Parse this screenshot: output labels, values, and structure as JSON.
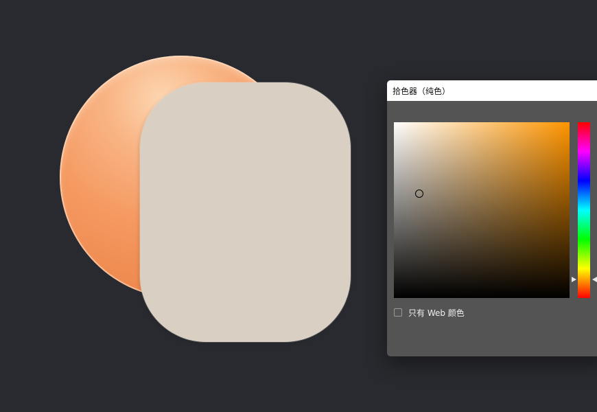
{
  "picker": {
    "title": "拾色器（纯色）",
    "web_colors_only_label": "只有 Web 颜色",
    "web_colors_only_checked": false,
    "hue_base_color": "#ff9500"
  },
  "canvas": {
    "background_color": "#292a2f",
    "circle_color": "#f59a62",
    "card_color": "#d9d0c3"
  }
}
